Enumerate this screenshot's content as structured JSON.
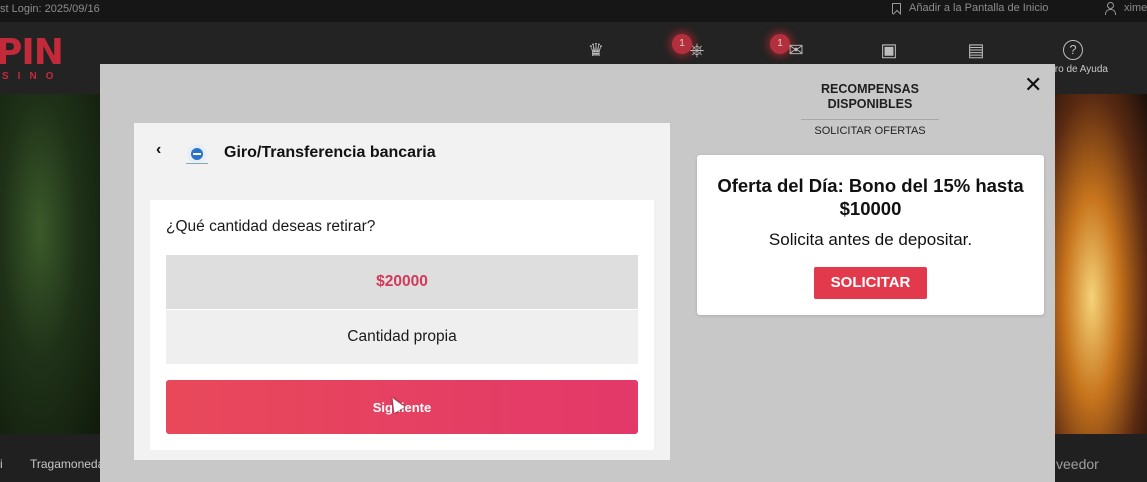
{
  "topbar": {
    "last_login": "st Login: 2025/09/16",
    "add_home": "Añadir a la Pantalla de Inicio",
    "username": "xime"
  },
  "header": {
    "logo_main": "PIN",
    "logo_sub": "SINO",
    "badges": {
      "wheel": "1",
      "mail": "1"
    },
    "help_label": "tro de Ayuda",
    "help_icon": "?"
  },
  "bottom_nav": {
    "item_left": "i",
    "item_left2": "Tragamoneda",
    "item_right": "veedor"
  },
  "modal": {
    "close_label": "✕",
    "back_label": "‹",
    "method_title": "Giro/Transferencia bancaria",
    "question": "¿Qué cantidad deseas retirar?",
    "amount_option": "$20000",
    "custom_option": "Cantidad propia",
    "next_button": "Siguiente",
    "rewards": {
      "title": "RECOMPENSAS DISPONIBLES",
      "tab": "SOLICITAR OFERTAS"
    },
    "offer": {
      "title": "Oferta del Día: Bono del 15% hasta $10000",
      "subtitle": "Solicita antes de depositar.",
      "button": "SOLICITAR"
    }
  },
  "colors": {
    "accent": "#e23a4c",
    "amount_text": "#d23a5a",
    "modal_bg": "#c8c8c8"
  }
}
